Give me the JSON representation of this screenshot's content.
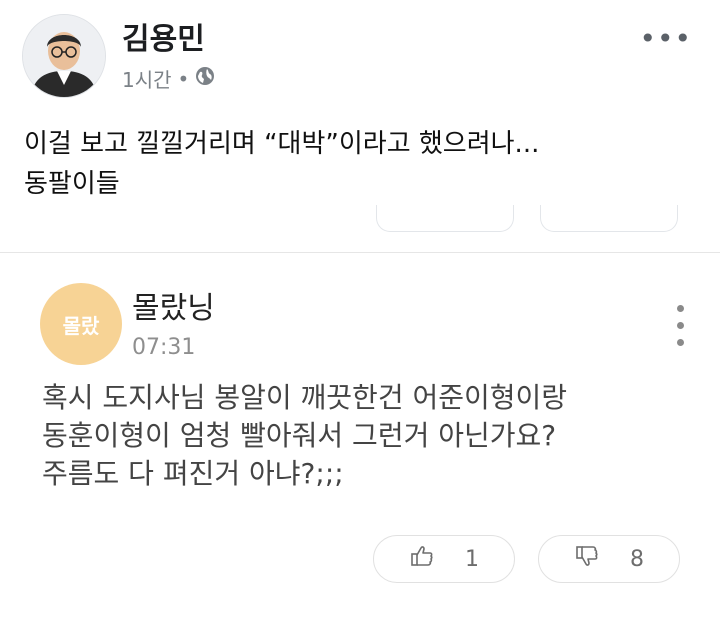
{
  "post": {
    "author": "김용민",
    "time": "1시간",
    "dot": "•",
    "more": "•••",
    "text_lines": [
      "이걸 보고 낄낄거리며 “대박”이라고 했으려나...",
      "동팔이들"
    ]
  },
  "comment": {
    "avatar_label": "몰랐",
    "author": "몰랐닝",
    "time": "07:31",
    "body_lines": [
      "혹시 도지사님 봉알이 깨끗한건 어준이형이랑",
      "동훈이형이 엄청 빨아줘서 그런거 아닌가요?",
      "주름도 다 펴진거 아냐?;;;"
    ],
    "likes": "1",
    "dislikes": "8"
  },
  "colors": {
    "comment_avatar_bg": "#f7d395",
    "meta_gray": "#7b8187"
  }
}
